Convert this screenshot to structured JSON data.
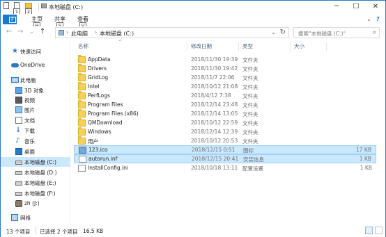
{
  "window": {
    "title": "本地磁盘 (C:)",
    "quick_access_keys": [
      "1",
      "2"
    ],
    "minimize": "─",
    "maximize": "☐",
    "close": "✕"
  },
  "ribbon": {
    "file_tab": "文件",
    "file_key": "F",
    "tabs": [
      {
        "label": "主页",
        "key": "H"
      },
      {
        "label": "共享",
        "key": "S"
      },
      {
        "label": "查看",
        "key": "V"
      }
    ],
    "expand": "⌄",
    "help": "?"
  },
  "nav": {
    "back": "←",
    "forward": "→",
    "recent": "⌄",
    "up": "↑",
    "breadcrumb": [
      "此电脑",
      "本地磁盘 (C:)"
    ],
    "search_placeholder": "搜索\"本地磁盘 (C:)\""
  },
  "sidebar": {
    "items": [
      {
        "label": "快速访问",
        "icon": "star-icon"
      },
      {
        "label": "OneDrive",
        "icon": "cloud-icon"
      },
      {
        "label": "此电脑",
        "icon": "computer-icon"
      },
      {
        "label": "3D 对象",
        "icon": "cube-icon"
      },
      {
        "label": "视频",
        "icon": "video-icon"
      },
      {
        "label": "图片",
        "icon": "picture-icon"
      },
      {
        "label": "文档",
        "icon": "document-icon"
      },
      {
        "label": "下载",
        "icon": "download-icon"
      },
      {
        "label": "音乐",
        "icon": "music-icon"
      },
      {
        "label": "桌面",
        "icon": "desktop-icon"
      },
      {
        "label": "本地磁盘 (C:)",
        "icon": "drive-icon"
      },
      {
        "label": "本地磁盘 (D:)",
        "icon": "drive-icon"
      },
      {
        "label": "本地磁盘 (E:)",
        "icon": "drive-icon"
      },
      {
        "label": "本地磁盘 (F:)",
        "icon": "drive-icon"
      },
      {
        "label": "zh (J:)",
        "icon": "user-drive-icon"
      },
      {
        "label": "网络",
        "icon": "network-icon"
      }
    ]
  },
  "columns": {
    "name": "名称",
    "date": "修改日期",
    "type": "类型",
    "size": "大小",
    "sort_indicator": "^"
  },
  "files": [
    {
      "name": "AppData",
      "date": "2018/11/30 19:39",
      "type": "文件夹",
      "size": "",
      "kind": "folder"
    },
    {
      "name": "Drivers",
      "date": "2018/11/30 19:42",
      "type": "文件夹",
      "size": "",
      "kind": "folder"
    },
    {
      "name": "GridLog",
      "date": "2018/11/7 22:06",
      "type": "文件夹",
      "size": "",
      "kind": "folder"
    },
    {
      "name": "Intel",
      "date": "2018/10/12 21:08",
      "type": "文件夹",
      "size": "",
      "kind": "folder"
    },
    {
      "name": "PerfLogs",
      "date": "2018/4/12 7:38",
      "type": "文件夹",
      "size": "",
      "kind": "folder"
    },
    {
      "name": "Program Files",
      "date": "2018/12/14 23:48",
      "type": "文件夹",
      "size": "",
      "kind": "folder"
    },
    {
      "name": "Program Files (x86)",
      "date": "2018/12/14 13:05",
      "type": "文件夹",
      "size": "",
      "kind": "folder"
    },
    {
      "name": "QMDownload",
      "date": "2018/10/12 22:59",
      "type": "文件夹",
      "size": "",
      "kind": "folder"
    },
    {
      "name": "Windows",
      "date": "2018/12/14 12:39",
      "type": "文件夹",
      "size": "",
      "kind": "folder"
    },
    {
      "name": "用户",
      "date": "2018/10/12 20:53",
      "type": "文件夹",
      "size": "",
      "kind": "folder"
    },
    {
      "name": "123.ico",
      "date": "2018/12/15 0:51",
      "type": "图标",
      "size": "17 KB",
      "kind": "image"
    },
    {
      "name": "autorun.inf",
      "date": "2018/12/15 20:41",
      "type": "安装信息",
      "size": "1 KB",
      "kind": "file"
    },
    {
      "name": "InstallConfig.ini",
      "date": "2018/10/18 13:11",
      "type": "配置设置",
      "size": "1 KB",
      "kind": "file"
    }
  ],
  "status": {
    "count": "13 个项目",
    "selected": "已选择 2 个项目",
    "size": "16.5 KB"
  },
  "colors": {
    "accent": "#1979ca",
    "selection": "#cce8ff",
    "selection_border": "#99d1ff",
    "folder": "#f7cf5b"
  }
}
